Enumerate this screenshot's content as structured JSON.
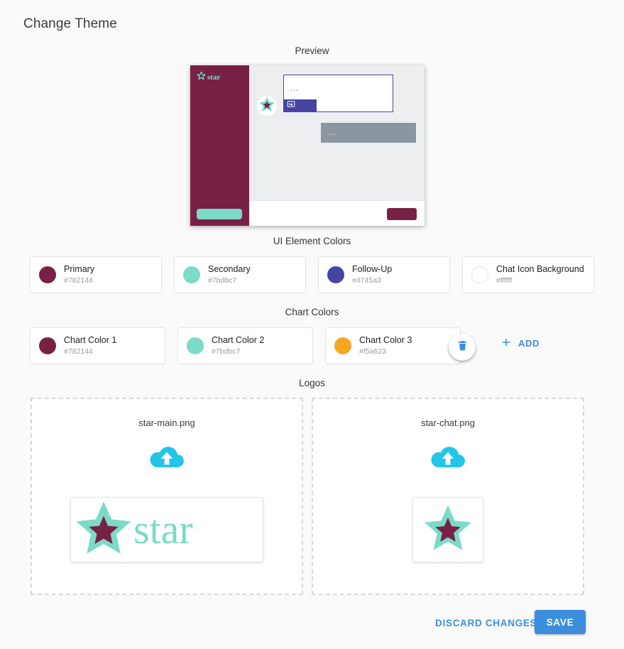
{
  "page": {
    "title": "Change Theme"
  },
  "sections": {
    "preview_label": "Preview",
    "ui_colors_label": "UI Element Colors",
    "chart_colors_label": "Chart Colors",
    "logos_label": "Logos"
  },
  "preview": {
    "brand_text": "star",
    "brand_star_icon": "star-outline-icon",
    "chat_avatar_icon": "star-icon",
    "bot_message_text": "...",
    "followup_icon": "reply-bubble-icon",
    "user_message_text": "...",
    "sidebar_color": "#782144",
    "sidebar_button_color": "#7bdbc7",
    "bot_bubble_border_color": "#4745a3",
    "followup_color": "#4745a3",
    "user_bubble_color": "#8b96a1",
    "footer_button_color": "#782144",
    "chat_icon_background": "#ffffff",
    "body_background": "#eceef0"
  },
  "ui_colors": [
    {
      "name": "Primary",
      "hex": "#782144",
      "swatch": "#782144",
      "empty": false
    },
    {
      "name": "Secondary",
      "hex": "#7bdbc7",
      "swatch": "#7bdbc7",
      "empty": false
    },
    {
      "name": "Follow-Up",
      "hex": "#4745a3",
      "swatch": "#4745a3",
      "empty": false
    },
    {
      "name": "Chat Icon Background",
      "hex": "#ffffff",
      "swatch": "#ffffff",
      "empty": true
    }
  ],
  "chart_colors": [
    {
      "name": "Chart Color 1",
      "hex": "#782144",
      "swatch": "#782144",
      "empty": false
    },
    {
      "name": "Chart Color 2",
      "hex": "#7bdbc7",
      "swatch": "#7bdbc7",
      "empty": false
    },
    {
      "name": "Chart Color 3",
      "hex": "#f5a623",
      "swatch": "#f5a623",
      "empty": false
    }
  ],
  "chart_colors_actions": {
    "delete_icon": "trash-icon",
    "delete_icon_color": "#3b8ede",
    "add_label": "ADD",
    "add_icon": "plus-icon",
    "add_color": "#3b8ede"
  },
  "logos": [
    {
      "filename": "star-main.png",
      "upload_icon": "cloud-upload-icon",
      "upload_icon_color": "#22c5e8",
      "logo_word": "star",
      "logo_star_outer_color": "#7bdbc7",
      "logo_star_inner_color": "#782144"
    },
    {
      "filename": "star-chat.png",
      "upload_icon": "cloud-upload-icon",
      "upload_icon_color": "#22c5e8",
      "logo_word": "",
      "logo_star_outer_color": "#7bdbc7",
      "logo_star_inner_color": "#782144"
    }
  ],
  "footer": {
    "discard_label": "DISCARD CHANGES",
    "save_label": "SAVE",
    "accent_color": "#3b8ede"
  }
}
